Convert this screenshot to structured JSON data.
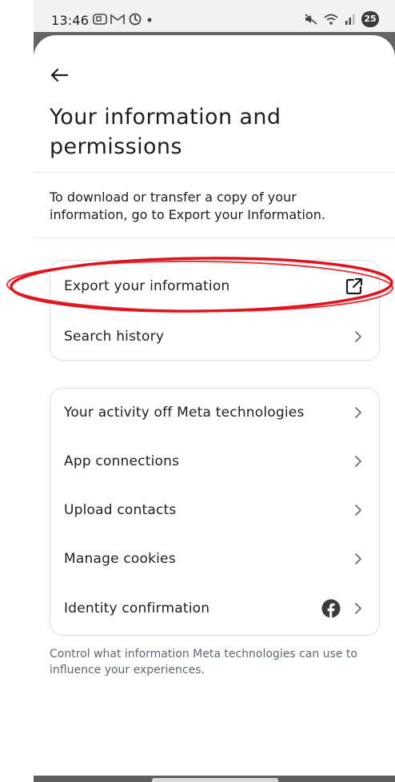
{
  "status_bar": {
    "time": "13:46",
    "battery": "25",
    "left_icons": [
      "screenshot-icon",
      "gmail-icon",
      "sync-icon",
      "dot-icon"
    ],
    "right_icons": [
      "mute-icon",
      "wifi-icon",
      "signal-icon"
    ]
  },
  "header": {
    "back_icon": "arrow-left-icon",
    "title": "Your information and permissions"
  },
  "description": "To download or transfer a copy of your information, go to Export your Information.",
  "group1": {
    "items": [
      {
        "label": "Export your information",
        "icon": "external-link-icon"
      },
      {
        "label": "Search history",
        "icon": "chevron-right-icon"
      }
    ]
  },
  "group2": {
    "items": [
      {
        "label": "Your activity off Meta technologies",
        "icon": "chevron-right-icon"
      },
      {
        "label": "App connections",
        "icon": "chevron-right-icon"
      },
      {
        "label": "Upload contacts",
        "icon": "chevron-right-icon"
      },
      {
        "label": "Manage cookies",
        "icon": "chevron-right-icon"
      },
      {
        "label": "Identity confirmation",
        "icon": "chevron-right-icon",
        "extra_icon": "facebook-icon"
      }
    ]
  },
  "footer": "Control what information Meta technologies can use to influence your experiences.",
  "colors": {
    "text": "#1c1e21",
    "secondary_text": "#606770",
    "border": "#dadde1",
    "annotation_red": "#e0141e",
    "facebook": "#3b3b3b"
  }
}
